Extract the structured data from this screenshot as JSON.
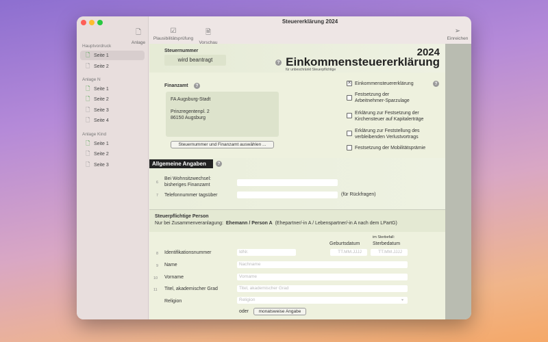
{
  "window": {
    "title": "Steuererklärung 2024"
  },
  "toolbar": {
    "anlage": "Anlage",
    "plausi": "Plausibilitätsprüfung",
    "vorschau": "Vorschau",
    "einreichen": "Einreichen"
  },
  "sidebar": {
    "sections": [
      {
        "label": "Hauptvordruck",
        "items": [
          "Seite 1",
          "Seite 2"
        ]
      },
      {
        "label": "Anlage N",
        "items": [
          "Seite 1",
          "Seite 2",
          "Seite 3",
          "Seite 4"
        ]
      },
      {
        "label": "Anlage Kind",
        "items": [
          "Seite 1",
          "Seite 2",
          "Seite 3"
        ]
      }
    ],
    "selected": "Hauptvordruck / Seite 1"
  },
  "header": {
    "steuernummer_label": "Steuernummer",
    "steuernummer_value": "wird beantragt",
    "year": "2024",
    "form_title": "Einkommensteuererklärung",
    "subtitle": "für unbeschränkt Steuerpflichtige"
  },
  "finanzamt": {
    "label": "Finanzamt",
    "name": "FA Augsburg-Stadt",
    "street": "Prinzregentenpl. 2",
    "city": "86150 Augsburg",
    "select_button": "Steuernummer und Finanzamt auswählen ..."
  },
  "checkboxes": [
    {
      "label": "Einkommensteuererklärung",
      "checked": true
    },
    {
      "label": "Festsetzung der\nArbeitnehmer-Sparzulage",
      "checked": false
    },
    {
      "label": "Erklärung zur Festsetzung der\nKirchensteuer auf Kapitalerträge",
      "checked": false
    },
    {
      "label": "Erklärung zur Feststellung des\nverbleibenden Verlustvortrags",
      "checked": false
    },
    {
      "label": "Festsetzung der Mobilitätsprämie",
      "checked": false
    }
  ],
  "allgemein": {
    "title": "Allgemeine Angaben",
    "rows": [
      {
        "num": "6",
        "label": "Bei Wohnsitzwechsel:\nbisheriges Finanzamt",
        "value": ""
      },
      {
        "num": "7",
        "label": "Telefonnummer tagsüber",
        "value": "",
        "suffix": "(für Rückfragen)"
      }
    ]
  },
  "person": {
    "title": "Steuerpflichtige Person",
    "note_prefix": "Nur bei Zusammenveranlagung:",
    "note_bold": "Ehemann / Person A",
    "note_suffix": "(Ehepartner/-in A / Lebenspartner/-in A nach dem LPartG)",
    "geburtsdatum": "Geburtsdatum",
    "sterbefall": "im Sterbefall:",
    "sterbedatum": "Sterbedatum",
    "rows": [
      {
        "num": "8",
        "label": "Identifikationsnummer",
        "placeholder": "IdNr.",
        "date_placeholder": "TT.MM.JJJJ"
      },
      {
        "num": "9",
        "label": "Name",
        "placeholder": "Nachname"
      },
      {
        "num": "10",
        "label": "Vorname",
        "placeholder": "Vorname"
      },
      {
        "num": "11",
        "label": "Titel, akademischer Grad",
        "placeholder": "Titel, akademischer Grad"
      },
      {
        "num": "",
        "label": "Religion",
        "placeholder": "Religion"
      }
    ],
    "oder": "oder",
    "monthly_button": "monatsweise Angabe"
  }
}
